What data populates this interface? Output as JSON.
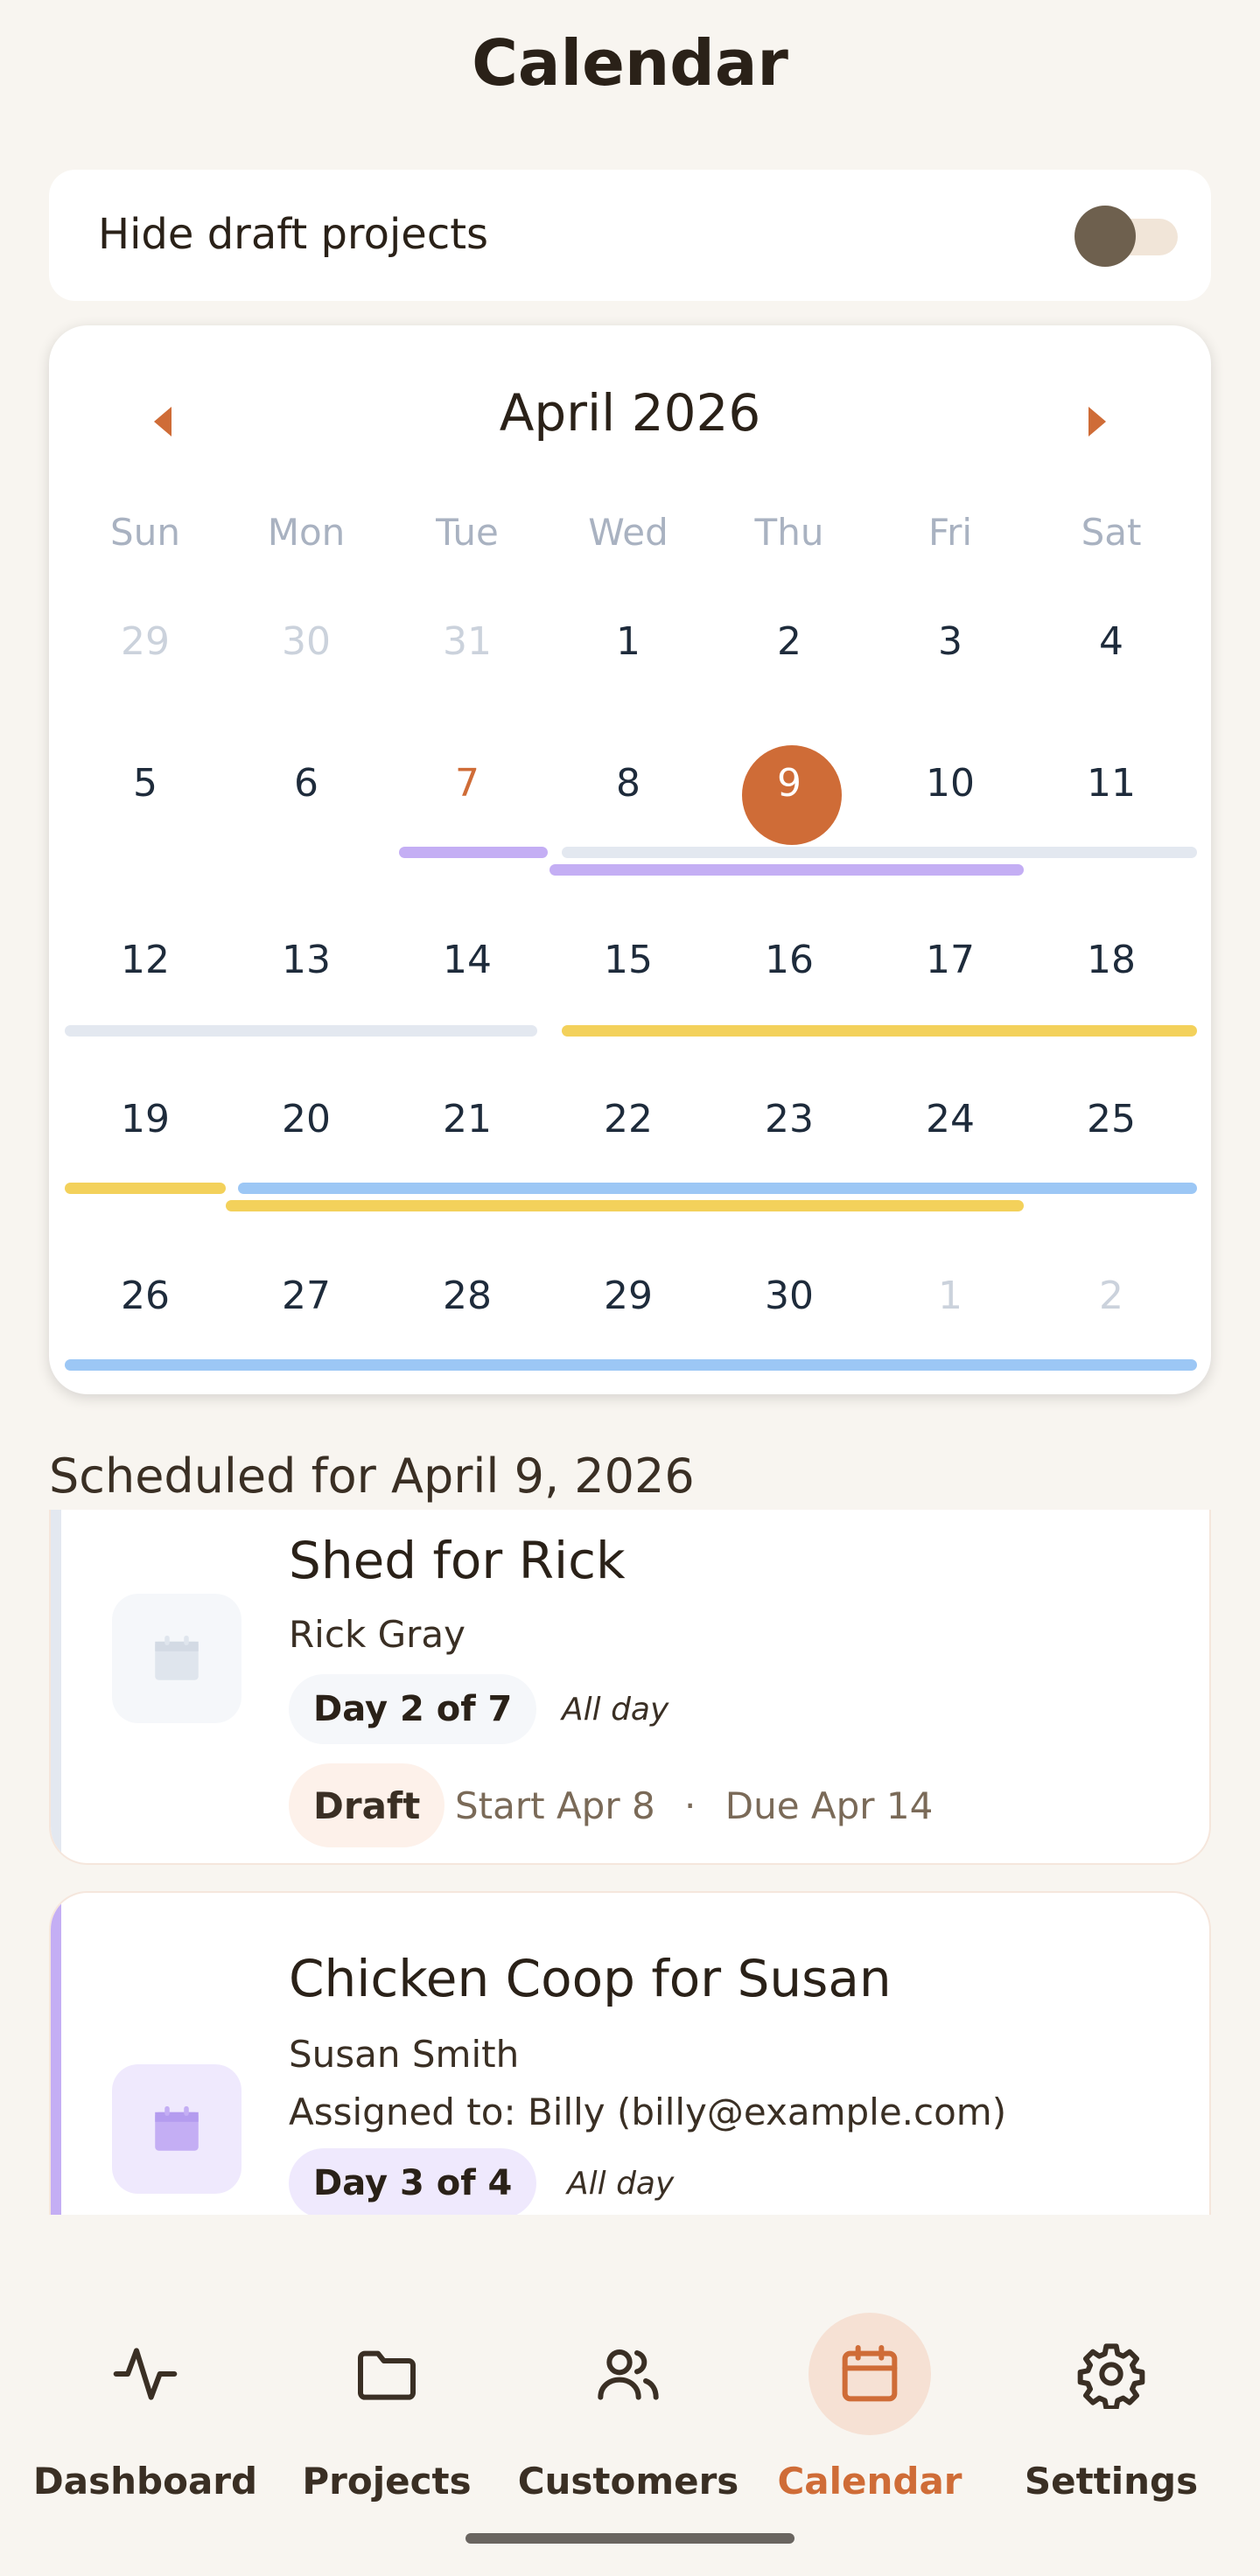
{
  "page": {
    "title": "Calendar"
  },
  "filter": {
    "label": "Hide draft projects",
    "enabled": false
  },
  "calendar": {
    "month_label": "April 2026",
    "weekdays": [
      "Sun",
      "Mon",
      "Tue",
      "Wed",
      "Thu",
      "Fri",
      "Sat"
    ],
    "weeks": [
      [
        "29",
        "30",
        "31",
        "1",
        "2",
        "3",
        "4"
      ],
      [
        "5",
        "6",
        "7",
        "8",
        "9",
        "10",
        "11"
      ],
      [
        "12",
        "13",
        "14",
        "15",
        "16",
        "17",
        "18"
      ],
      [
        "19",
        "20",
        "21",
        "22",
        "23",
        "24",
        "25"
      ],
      [
        "26",
        "27",
        "28",
        "29",
        "30",
        "1",
        "2"
      ]
    ],
    "selected_day": "9",
    "highlighted_day": "7",
    "colors": {
      "accent": "#cf6c37",
      "grey": "#e3e8f0",
      "purple": "#c4aef4",
      "yellow": "#f3d15b",
      "blue": "#9cc7f5"
    }
  },
  "schedule": {
    "heading": "Scheduled for April 9, 2026",
    "projects": [
      {
        "title": "Shed for Rick",
        "customer": "Rick Gray",
        "day_badge": "Day 2 of 7",
        "time": "All day",
        "status": "Draft",
        "start": "Start Apr 8",
        "separator": "·",
        "due": "Due Apr 14",
        "color": "#e3e8f0"
      },
      {
        "title": "Chicken Coop for Susan",
        "customer": "Susan Smith",
        "assigned": "Assigned to: Billy (billy@example.com)",
        "day_badge": "Day 3 of 4",
        "time": "All day",
        "color": "#c4aef4"
      }
    ]
  },
  "nav": {
    "items": [
      {
        "label": "Dashboard",
        "icon": "activity-icon",
        "active": false
      },
      {
        "label": "Projects",
        "icon": "folder-icon",
        "active": false
      },
      {
        "label": "Customers",
        "icon": "users-icon",
        "active": false
      },
      {
        "label": "Calendar",
        "icon": "calendar-icon",
        "active": true
      },
      {
        "label": "Settings",
        "icon": "gear-icon",
        "active": false
      }
    ]
  }
}
